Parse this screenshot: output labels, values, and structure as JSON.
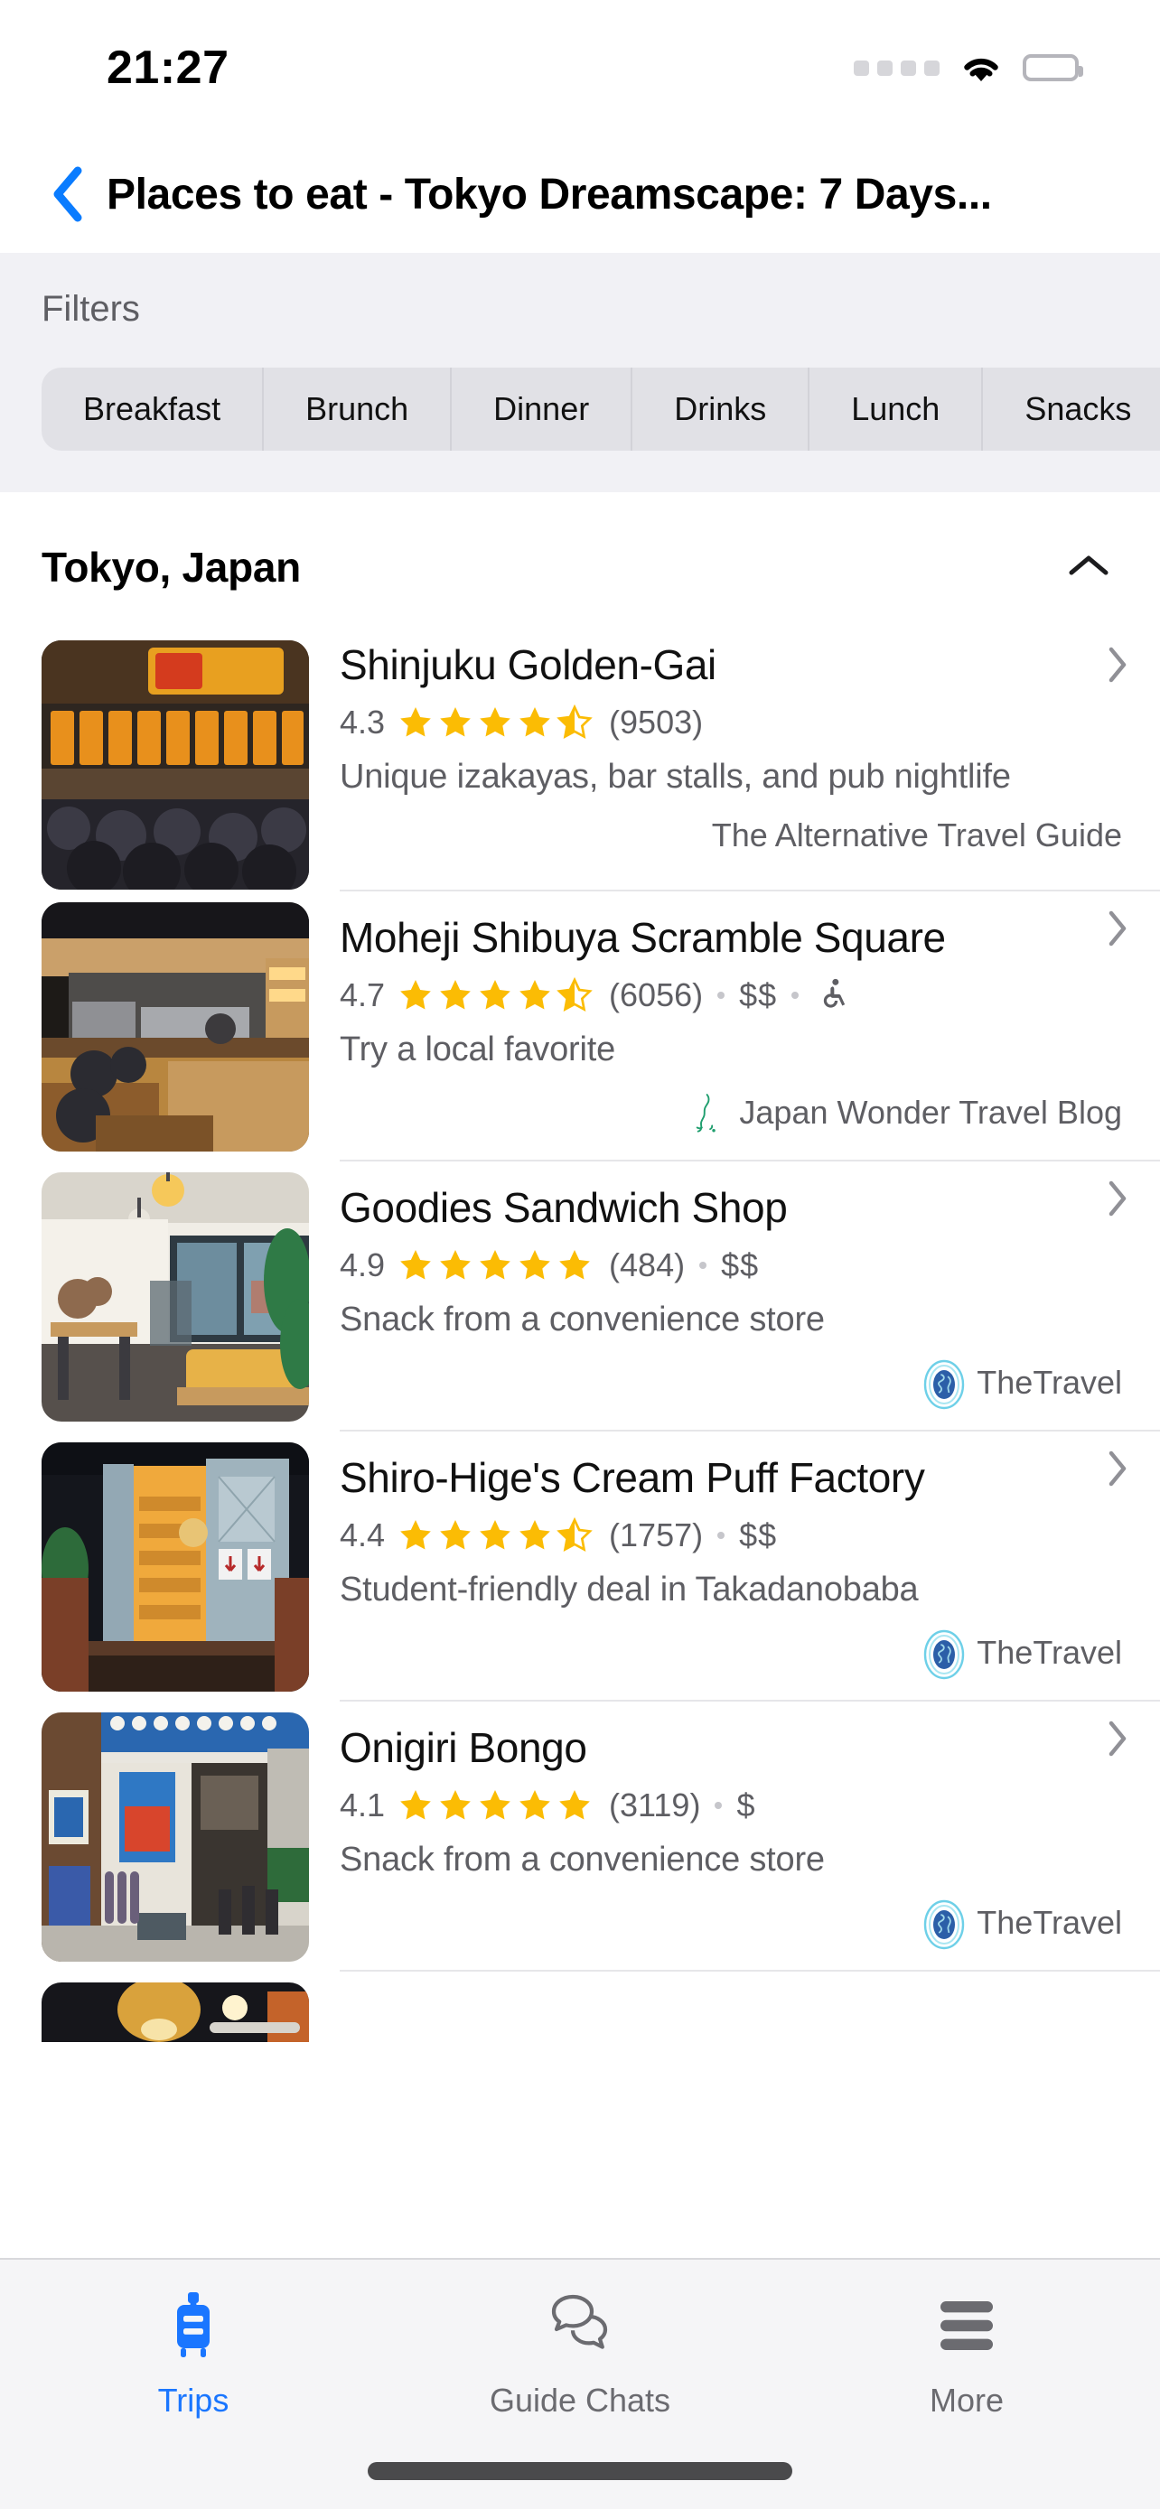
{
  "status_bar": {
    "time": "21:27",
    "signal_icon": "signal-dots-icon",
    "wifi_icon": "wifi-icon",
    "battery_icon": "battery-full-icon"
  },
  "header": {
    "back_icon": "chevron-left-icon",
    "title": "Places to eat - Tokyo Dreamscape: 7 Days..."
  },
  "filters": {
    "label": "Filters",
    "chips": [
      "Breakfast",
      "Brunch",
      "Dinner",
      "Drinks",
      "Lunch",
      "Snacks"
    ]
  },
  "section": {
    "title": "Tokyo, Japan",
    "collapse_icon": "chevron-up-icon"
  },
  "places": [
    {
      "name": "Shinjuku Golden-Gai",
      "rating": "4.3",
      "stars_full": 4,
      "stars_half": 1,
      "reviews": "(9503)",
      "price": "",
      "accessible": false,
      "blurb": "Unique izakayas, bar stalls, and pub nightlife",
      "source": "The Alternative Travel Guide",
      "source_logo": "none",
      "chevron_icon": "chevron-right-icon",
      "thumb_alt": "izakaya-interior-thumbnail"
    },
    {
      "name": "Moheji Shibuya Scramble Square",
      "rating": "4.7",
      "stars_full": 4,
      "stars_half": 1,
      "reviews": "(6056)",
      "price": "$$",
      "accessible": true,
      "blurb": "Try a local favorite",
      "source": "Japan Wonder Travel Blog",
      "source_logo": "japan-map-icon",
      "chevron_icon": "chevron-right-icon",
      "thumb_alt": "restaurant-kitchen-counter-thumbnail"
    },
    {
      "name": "Goodies Sandwich Shop",
      "rating": "4.9",
      "stars_full": 5,
      "stars_half": 0,
      "reviews": "(484)",
      "price": "$$",
      "accessible": false,
      "blurb": "Snack from a convenience store",
      "source": "TheTravel",
      "source_logo": "globe-icon",
      "chevron_icon": "chevron-right-icon",
      "thumb_alt": "bright-cafe-interior-thumbnail"
    },
    {
      "name": "Shiro-Hige's Cream Puff Factory",
      "rating": "4.4",
      "stars_full": 4,
      "stars_half": 1,
      "reviews": "(1757)",
      "price": "$$",
      "accessible": false,
      "blurb": "Student-friendly deal in Takadanobaba",
      "source": "TheTravel",
      "source_logo": "globe-icon",
      "chevron_icon": "chevron-right-icon",
      "thumb_alt": "lit-doorway-stairs-thumbnail"
    },
    {
      "name": "Onigiri Bongo",
      "rating": "4.1",
      "stars_full": 5,
      "stars_half": 0,
      "reviews": "(3119)",
      "price": "$",
      "accessible": false,
      "blurb": "Snack from a convenience store",
      "source": "TheTravel",
      "source_logo": "globe-icon",
      "chevron_icon": "chevron-right-icon",
      "thumb_alt": "japanese-storefront-thumbnail"
    }
  ],
  "tabbar": {
    "items": [
      {
        "label": "Trips",
        "icon": "suitcase-icon",
        "active": true
      },
      {
        "label": "Guide Chats",
        "icon": "chat-bubbles-icon",
        "active": false
      },
      {
        "label": "More",
        "icon": "hamburger-menu-icon",
        "active": false
      }
    ]
  },
  "colors": {
    "accent": "#1a76ff",
    "star": "#fbbc04",
    "text_secondary": "#5e5e63",
    "filter_bg": "#f1f1f5",
    "chip_bg": "#e1e1e6"
  }
}
